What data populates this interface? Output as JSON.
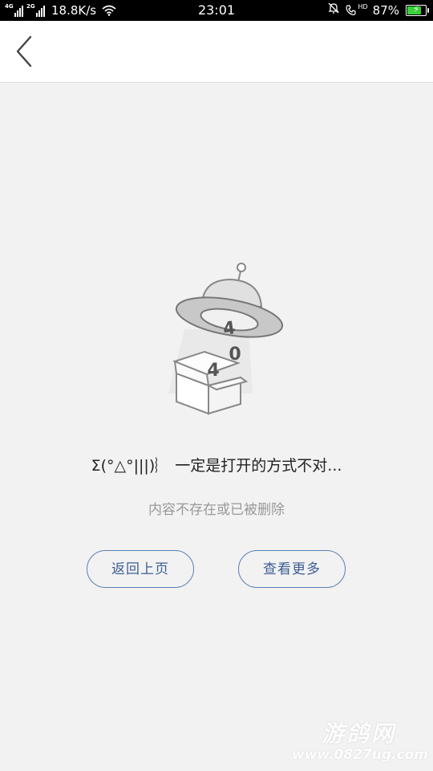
{
  "status_bar": {
    "net1": "4G",
    "net2": "2G",
    "speed": "18.8K/s",
    "time": "23:01",
    "hd": "HD",
    "battery_percent": "87%",
    "battery_level": 0.87,
    "icons": [
      "signal-icon",
      "wifi-icon",
      "alarm-off-icon",
      "call-hd-icon",
      "battery-icon"
    ]
  },
  "header": {
    "back_icon": "chevron-left-icon"
  },
  "illustration": {
    "ufo_digit": "4",
    "middle_digit": "0",
    "box_digit": "4"
  },
  "message": {
    "title": "Σ(°△°|||)︴ 一定是打开的方式不对...",
    "subtitle": "内容不存在或已被删除"
  },
  "actions": {
    "back_label": "返回上页",
    "more_label": "查看更多",
    "accent_color": "#5a7fb5"
  },
  "watermark": {
    "title": "游鸽网",
    "url": "www.0827ug.com"
  }
}
